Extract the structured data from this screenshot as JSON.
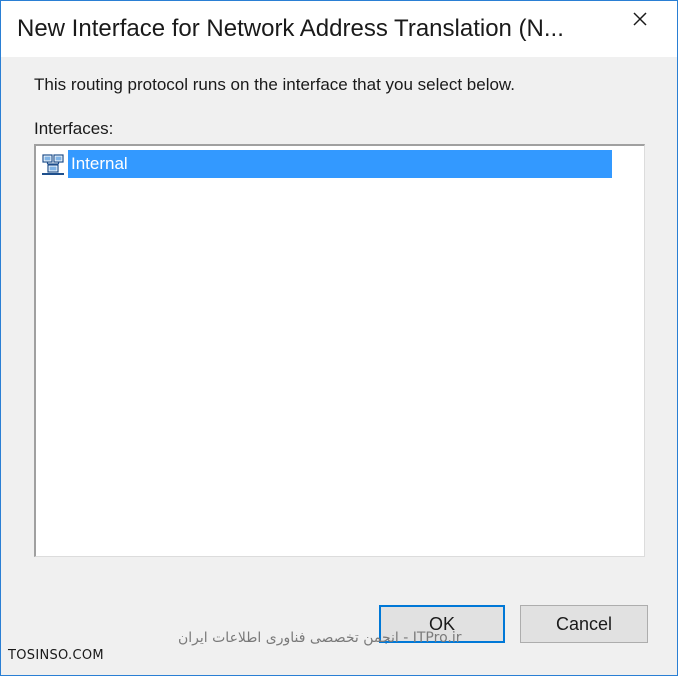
{
  "window": {
    "title": "New Interface for Network Address Translation (N...",
    "close_icon": "close-icon"
  },
  "dialog": {
    "description": "This routing protocol runs on the interface that you select below.",
    "list_label": "Interfaces:",
    "interfaces": [
      {
        "name": "Internal",
        "icon": "network-interface-icon",
        "selected": true
      }
    ]
  },
  "buttons": {
    "ok_label": "OK",
    "cancel_label": "Cancel"
  },
  "watermark": {
    "site": "TOSINSO.COM",
    "text": "انجمن تخصصی فناوری اطلاعات ایران - ITPro.ir"
  },
  "colors": {
    "selection": "#3399ff",
    "window_border": "#2a7fd4",
    "default_button_border": "#0078d7",
    "background": "#f0f0f0"
  }
}
